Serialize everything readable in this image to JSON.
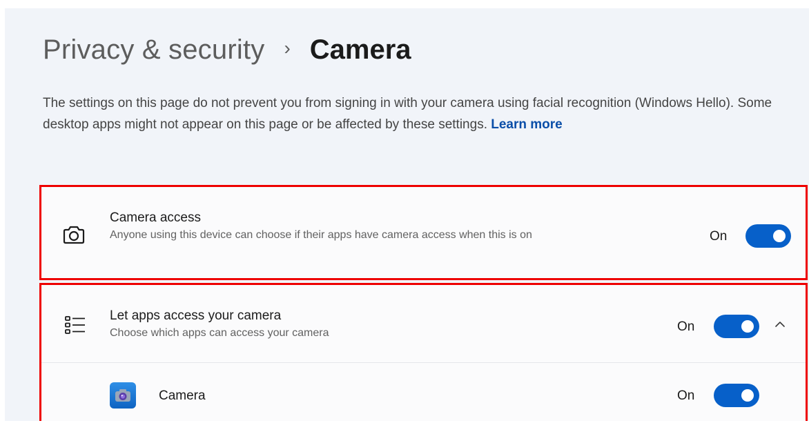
{
  "breadcrumb": {
    "parent": "Privacy & security",
    "separator": "›",
    "current": "Camera"
  },
  "description": {
    "text": "The settings on this page do not prevent you from signing in with your camera using facial recognition (Windows Hello). Some desktop apps might not appear on this page or be affected by these settings.",
    "link": "Learn more"
  },
  "camera_access": {
    "title": "Camera access",
    "subtitle": "Anyone using this device can choose if their apps have camera access when this is on",
    "state_label": "On",
    "toggle_on": true,
    "icon": "camera-icon"
  },
  "apps_access": {
    "title": "Let apps access your camera",
    "subtitle": "Choose which apps can access your camera",
    "state_label": "On",
    "toggle_on": true,
    "icon": "app-list-icon",
    "expander_icon": "chevron-up-icon"
  },
  "apps": [
    {
      "name": "Camera",
      "state_label": "On",
      "toggle_on": true,
      "icon": "camera-app-icon"
    }
  ],
  "colors": {
    "accent": "#0760c9",
    "highlight_border": "#ee0000",
    "link": "#0a4ea8"
  }
}
